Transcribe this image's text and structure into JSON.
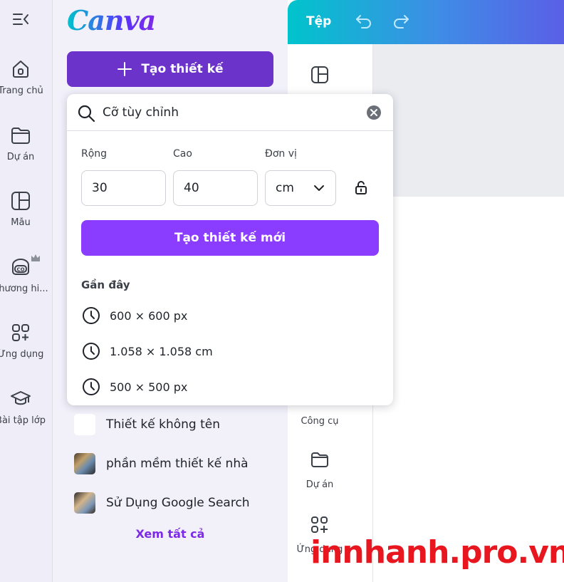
{
  "brand": {
    "logo_text": "Canva"
  },
  "rail": {
    "items": [
      {
        "label": "Trang chủ"
      },
      {
        "label": "Dự án"
      },
      {
        "label": "Mẫu"
      },
      {
        "label": "Thương hi..."
      },
      {
        "label": "Ứng dụng"
      },
      {
        "label": "Bài tập lớp"
      }
    ]
  },
  "panel": {
    "create_label": "Tạo thiết kế",
    "recent_designs": [
      {
        "label": "Thiết kế không tên"
      },
      {
        "label": "phần mềm thiết kế nhà"
      },
      {
        "label": "Sử Dụng Google Search"
      }
    ],
    "see_all": "Xem tất cả"
  },
  "editor": {
    "file_label": "Tệp",
    "strip_labels": {
      "tools": "Công cụ",
      "projects": "Dự án",
      "apps": "Ứng dụng"
    }
  },
  "popover": {
    "search_value": "Cỡ tùy chỉnh",
    "width_label": "Rộng",
    "height_label": "Cao",
    "unit_label": "Đơn vị",
    "width_value": "30",
    "height_value": "40",
    "unit_value": "cm",
    "create_new_label": "Tạo thiết kế mới",
    "recent_heading": "Gần đây",
    "recent_sizes": [
      {
        "label": "600 × 600 px"
      },
      {
        "label": "1.058 × 1.058 cm"
      },
      {
        "label": "500 × 500 px"
      }
    ]
  },
  "watermark": "innhanh.pro.vn",
  "colors": {
    "brand_purple": "#7d2ae8",
    "create_button": "#6b33c9",
    "primary_button": "#8b3dff",
    "header_gradient_start": "#00c4cc",
    "header_gradient_end": "#5a5fe6",
    "watermark_red": "#e8161f"
  },
  "icons": {
    "rail": [
      "menu-collapse-icon",
      "home-icon",
      "folder-icon",
      "template-icon",
      "brand-kit-icon",
      "apps-icon",
      "graduation-cap-icon"
    ],
    "popover": [
      "search-icon",
      "clear-icon",
      "chevron-down-icon",
      "lock-icon",
      "clock-icon"
    ]
  }
}
